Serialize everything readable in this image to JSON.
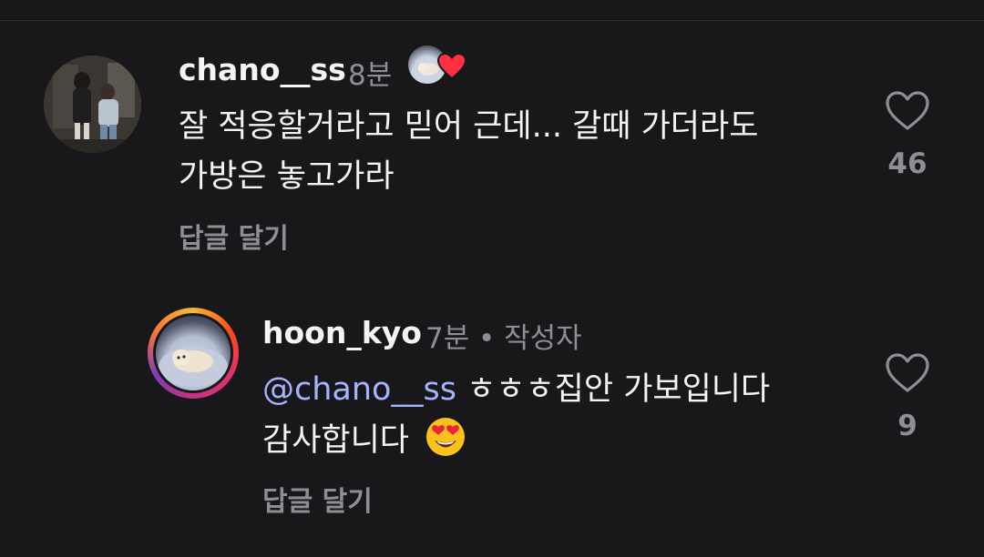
{
  "comments": [
    {
      "username": "chano__ss",
      "time": "8분",
      "line1": "잘 적응할거라고 믿어 근데... 갈때 가더라도",
      "line2": "가방은 놓고가라",
      "reply_label": "답글 달기",
      "like_count": "46",
      "liked_by_author": true
    },
    {
      "username": "hoon_kyo",
      "time": "7분",
      "author_label": "• 작성자",
      "mention": "@chano__ss",
      "line1_rest": " ㅎㅎㅎ집안 가보입니다",
      "line2": "감사합니다",
      "emoji": "😍",
      "reply_label": "답글 달기",
      "like_count": "9"
    }
  ],
  "icons": {
    "like": "heart-outline-icon",
    "author_liked": "heart-filled-icon",
    "emoji": "heart-eyes-emoji"
  },
  "colors": {
    "background": "#18181a",
    "secondary_text": "#8e8e93",
    "mention": "#a4b4ff",
    "heart_red": "#ff3040"
  }
}
